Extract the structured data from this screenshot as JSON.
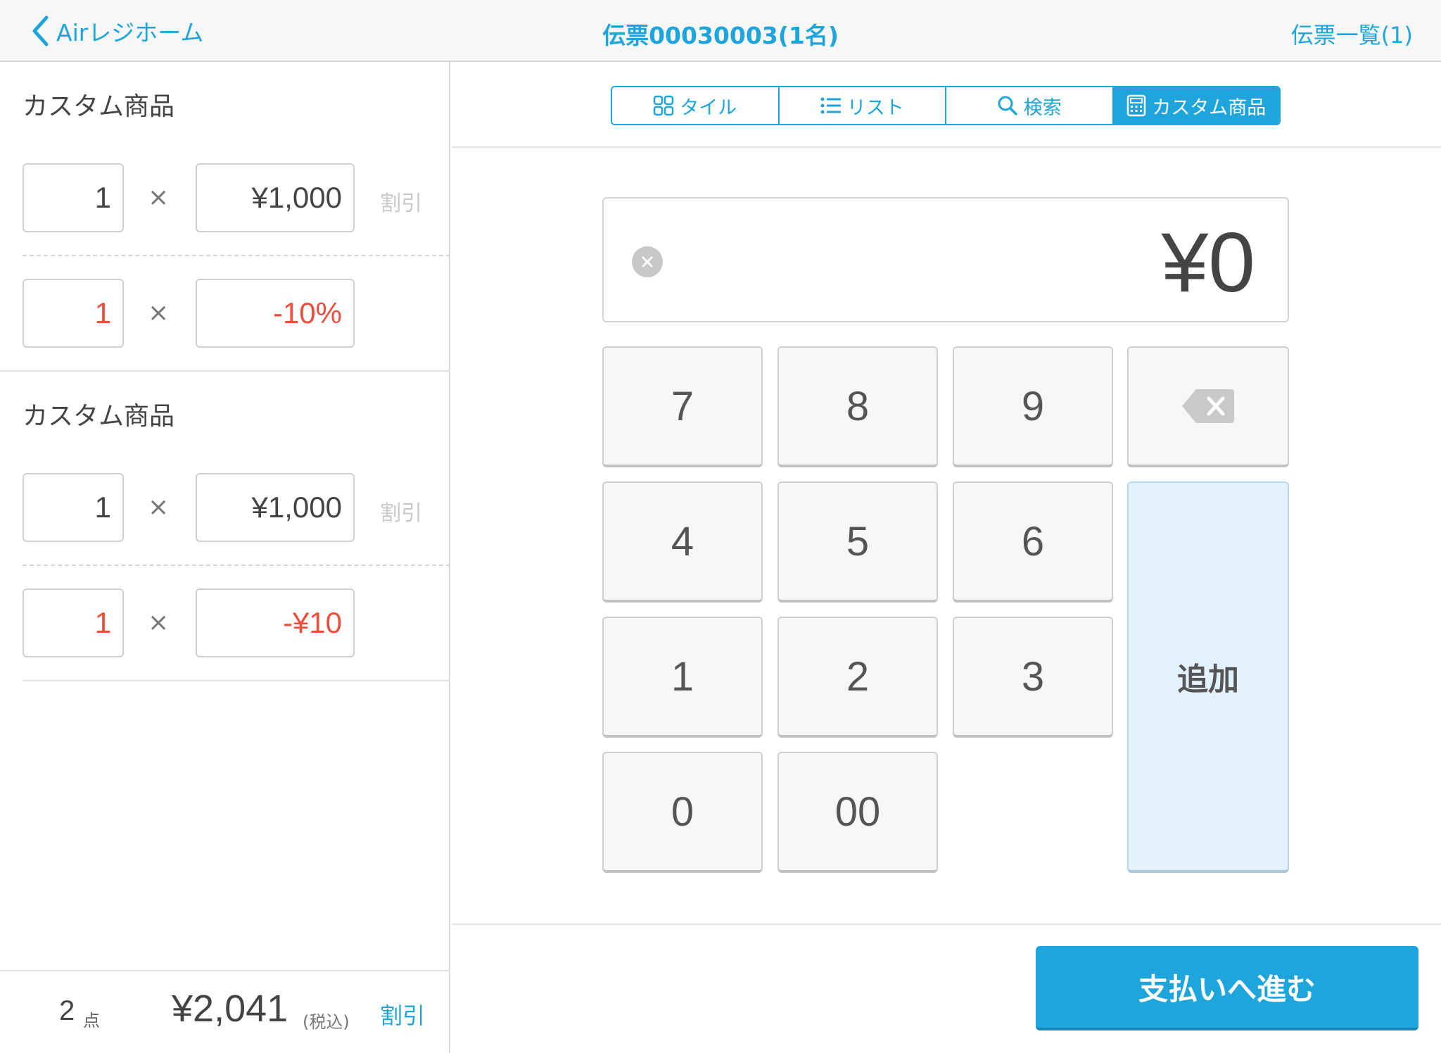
{
  "header": {
    "back_label": "Airレジホーム",
    "title": "伝票00030003(1名)",
    "right_label": "伝票一覧(1)"
  },
  "items": [
    {
      "title": "カスタム商品",
      "line": {
        "qty": "1",
        "price": "¥1,000",
        "discount_label": "割引"
      },
      "discount": {
        "qty": "1",
        "value": "-10%"
      }
    },
    {
      "title": "カスタム商品",
      "line": {
        "qty": "1",
        "price": "¥1,000",
        "discount_label": "割引"
      },
      "discount": {
        "qty": "1",
        "value": "-¥10"
      }
    }
  ],
  "times_symbol": "×",
  "footer": {
    "count": "2",
    "count_unit": "点",
    "total": "¥2,041",
    "tax_label": "(税込)",
    "discount_label": "割引"
  },
  "tabs": [
    {
      "label": "タイル",
      "icon": "grid-icon"
    },
    {
      "label": "リスト",
      "icon": "list-icon"
    },
    {
      "label": "検索",
      "icon": "search-icon"
    },
    {
      "label": "カスタム商品",
      "icon": "calculator-icon",
      "active": true
    }
  ],
  "keypad": {
    "display": "¥0",
    "keys": [
      "7",
      "8",
      "9",
      "4",
      "5",
      "6",
      "1",
      "2",
      "3",
      "0",
      "00"
    ],
    "add_label": "追加"
  },
  "pay_button_label": "支払いへ進む",
  "colors": {
    "accent": "#1da5dc",
    "discount_red": "#f04e3c",
    "add_key_bg": "#e3f2fd"
  }
}
